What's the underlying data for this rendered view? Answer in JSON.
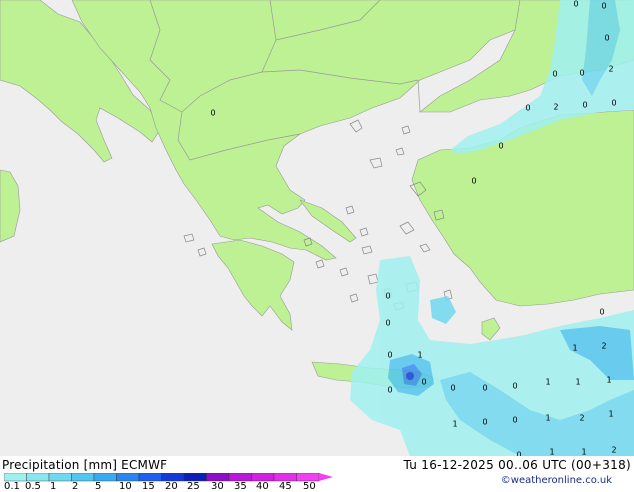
{
  "title": {
    "left": "Precipitation [mm]  ECMWF",
    "right": "Tu 16-12-2025 00..06 UTC (00+318)"
  },
  "credit": "©weatheronline.co.uk",
  "legend": {
    "ticks": [
      "0.1",
      "0.5",
      "1",
      "2",
      "5",
      "10",
      "15",
      "20",
      "25",
      "30",
      "35",
      "40",
      "45",
      "50"
    ],
    "colors": [
      "#a0f0f0",
      "#8ae6ee",
      "#70d8ee",
      "#52c6ee",
      "#3aaaf0",
      "#2a86ee",
      "#1e5ef0",
      "#1638d8",
      "#0c20b8",
      "#8c10c8",
      "#b818d8",
      "#d020e0",
      "#e030e8",
      "#f040f0"
    ]
  },
  "map_colors": {
    "sea": "#eeeeee",
    "land": "#bef094",
    "border": "#999999",
    "precip_light": "#a0f0f0",
    "precip_medium": "#5ed2f0",
    "precip_heavy": "#3a8ef0",
    "precip_max": "#1a3ee0"
  },
  "point_values": [
    {
      "text": "0"
    },
    {
      "text": "0"
    },
    {
      "text": "0"
    },
    {
      "text": "0"
    },
    {
      "text": "0"
    },
    {
      "text": "2"
    },
    {
      "text": "0"
    },
    {
      "text": "2"
    },
    {
      "text": "0"
    },
    {
      "text": "0"
    },
    {
      "text": "0"
    },
    {
      "text": "0"
    },
    {
      "text": "0"
    },
    {
      "text": "0"
    },
    {
      "text": "0"
    },
    {
      "text": "0"
    },
    {
      "text": "0"
    },
    {
      "text": "0"
    },
    {
      "text": "1"
    },
    {
      "text": "2"
    },
    {
      "text": "0"
    },
    {
      "text": "0"
    },
    {
      "text": "1"
    },
    {
      "text": "0"
    },
    {
      "text": "0"
    },
    {
      "text": "1"
    },
    {
      "text": "1"
    },
    {
      "text": "1"
    },
    {
      "text": "1"
    },
    {
      "text": "0"
    },
    {
      "text": "0"
    },
    {
      "text": "2"
    },
    {
      "text": "1"
    },
    {
      "text": "1"
    },
    {
      "text": "0"
    },
    {
      "text": "1"
    },
    {
      "text": "2"
    },
    {
      "text": "1"
    }
  ]
}
